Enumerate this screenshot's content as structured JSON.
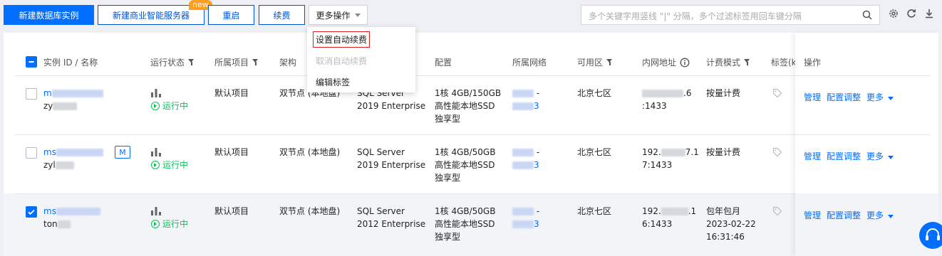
{
  "toolbar": {
    "new_instance": "新建数据库实例",
    "new_bi_server": "新建商业智能服务器",
    "new_badge": "new",
    "restart": "重启",
    "renew": "续费",
    "more_actions": "更多操作"
  },
  "search": {
    "placeholder": "多个关键字用竖线 \"|\" 分隔，多个过滤标签用回车键分隔"
  },
  "dropdown": {
    "items": [
      {
        "label": "设置自动续费",
        "state": "highlighted"
      },
      {
        "label": "取消自动续费",
        "state": "disabled"
      },
      {
        "label": "编辑标签",
        "state": "normal"
      }
    ]
  },
  "table": {
    "columns": {
      "id_name": "实例 ID / 名称",
      "status": "运行状态",
      "project": "所属项目",
      "arch": "架构",
      "config": "配置",
      "network": "所属网络",
      "zone": "可用区",
      "ip": "内网地址",
      "billing": "计费模式",
      "tags": "标签(k",
      "ops": "操作"
    },
    "rows": [
      {
        "id": "m",
        "name": "zy",
        "status": "运行中",
        "project": "默认项目",
        "arch": "双节点 (本地盘)",
        "version_1": "SQL Server",
        "version_2": "2019 Enterprise",
        "config_1": "1核 4GB/150GB",
        "config_2": "高性能本地SSD",
        "config_3": "独享型",
        "net_1": "-",
        "net_2": "3",
        "zone": "北京七区",
        "ip_1": ".6",
        "ip_2": ":1433",
        "billing_1": "按量计费",
        "billing_2": "",
        "billing_3": "",
        "checked": false,
        "has_m_badge": false
      },
      {
        "id": "ms",
        "name": "zyl",
        "status": "运行中",
        "project": "默认项目",
        "arch": "双节点 (本地盘)",
        "version_1": "SQL Server",
        "version_2": "2019 Enterprise",
        "config_1": "1核 4GB/50GB",
        "config_2": "高性能本地SSD",
        "config_3": "独享型",
        "net_1": "-",
        "net_2": "3",
        "zone": "北京七区",
        "ip_1": "192.",
        "ip_1b": "7.1",
        "ip_2": "7:1433",
        "billing_1": "按量计费",
        "billing_2": "",
        "billing_3": "",
        "checked": false,
        "has_m_badge": true,
        "m_badge": "M"
      },
      {
        "id": "ms",
        "name": "ton",
        "status": "运行中",
        "project": "默认项目",
        "arch": "双节点 (本地盘)",
        "version_1": "SQL Server",
        "version_2": "2012 Enterprise",
        "config_1": "1核 4GB/50GB",
        "config_2": "高性能本地SSD",
        "config_3": "独享型",
        "net_1": "-",
        "net_2": "3",
        "zone": "北京七区",
        "ip_1": "192.",
        "ip_1b": ".1",
        "ip_2": "6:1433",
        "billing_1": "包年包月",
        "billing_2": "2023-02-22",
        "billing_3": "16:31:46",
        "checked": true,
        "has_m_badge": false
      }
    ],
    "ops": {
      "manage": "管理",
      "resize": "配置调整",
      "more": "更多"
    }
  },
  "colors": {
    "primary": "#006eff",
    "running": "#0abf5b",
    "highlight_border": "#e02020",
    "new_badge": "#ff9d1f"
  },
  "icons": [
    "search-icon",
    "gear-icon",
    "refresh-icon",
    "download-icon",
    "filter-icon",
    "info-icon",
    "monitor-chart-icon",
    "play-circle-icon",
    "tag-icon",
    "chevron-down-icon",
    "headset-icon"
  ]
}
